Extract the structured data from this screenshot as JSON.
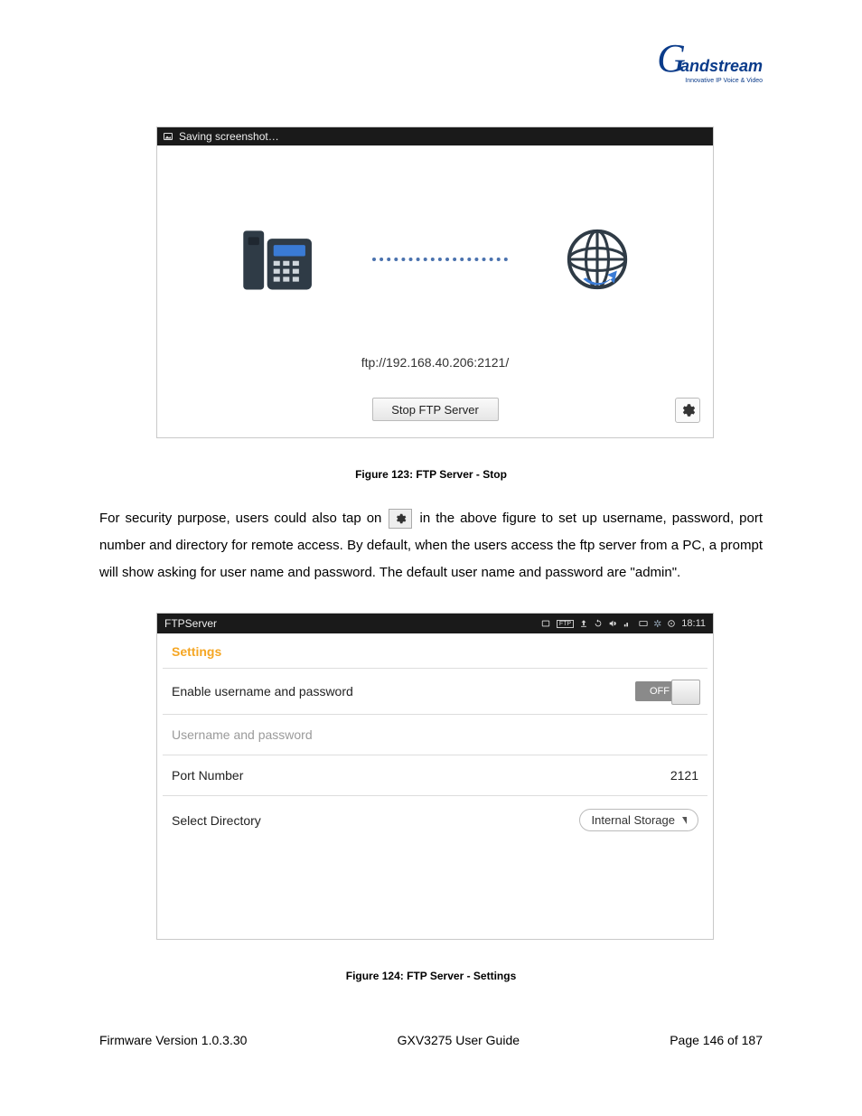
{
  "logo": {
    "brand_initial": "G",
    "brand_rest": "andstream",
    "tagline": "Innovative IP Voice & Video"
  },
  "shot1": {
    "titlebar": "Saving screenshot…",
    "ftp_url": "ftp://192.168.40.206:2121/",
    "stop_button": "Stop FTP Server"
  },
  "captions": {
    "fig123": "Figure 123: FTP Server - Stop",
    "fig124": "Figure 124: FTP Server - Settings"
  },
  "paragraph": {
    "p1a": "For security purpose, users could also tap on ",
    "p1b": " in the above figure to set up username, password, port number and directory for remote access. By default, when the users access the ftp server from a PC, a prompt will show asking for user name and password. The default user name and password are \"admin\"."
  },
  "shot2": {
    "app_name": "FTPServer",
    "clock": "18:11",
    "settings_header": "Settings",
    "rows": {
      "enable_label": "Enable username and password",
      "enable_value": "OFF",
      "userpass_label": "Username and password",
      "port_label": "Port Number",
      "port_value": "2121",
      "dir_label": "Select Directory",
      "dir_value": "Internal Storage"
    }
  },
  "footer": {
    "left": "Firmware Version 1.0.3.30",
    "center": "GXV3275 User Guide",
    "right": "Page 146 of 187"
  }
}
